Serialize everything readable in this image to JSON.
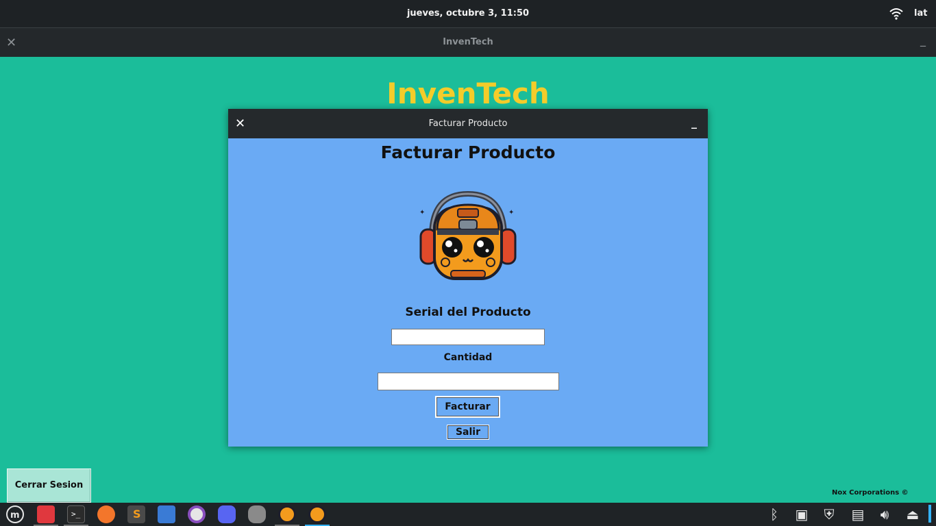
{
  "topbar": {
    "clock": "jueves, octubre  3, 11:50",
    "keyboard_layout": "lat",
    "wifi_icon": "wifi-icon"
  },
  "main_window": {
    "title": "InvenTech",
    "close_icon": "close-icon",
    "minimize_icon": "minimize-icon",
    "heading": "InvenTech",
    "logout_button": "Cerrar Sesion",
    "copyright": "Nox Corporations ©"
  },
  "dialog": {
    "title": "Facturar Producto",
    "heading": "Facturar Producto",
    "mascot": "robot-mascot-with-headphones",
    "serial_label": "Serial del Producto",
    "serial_value": "",
    "quantity_label": "Cantidad",
    "quantity_value": "",
    "submit_button": "Facturar",
    "exit_button": "Salir"
  },
  "taskbar": {
    "apps": [
      "mint-menu-icon",
      "files-icon",
      "terminal-icon",
      "firefox-icon",
      "sublime-text-icon",
      "screenshot-icon",
      "media-icon",
      "discord-icon",
      "database-icon",
      "inventech-app-icon",
      "inventech-dialog-icon"
    ],
    "tray": [
      "bluetooth-icon",
      "update-manager-icon",
      "shield-icon",
      "clipboard-icon",
      "volume-icon",
      "eject-icon"
    ]
  },
  "colors": {
    "desktop_bg": "#1bbd9a",
    "dialog_bg": "#6aaaf4",
    "heading_yellow": "#f4cc2a",
    "taskbar_bg": "#1f2326",
    "active_accent": "#35b4ff"
  }
}
